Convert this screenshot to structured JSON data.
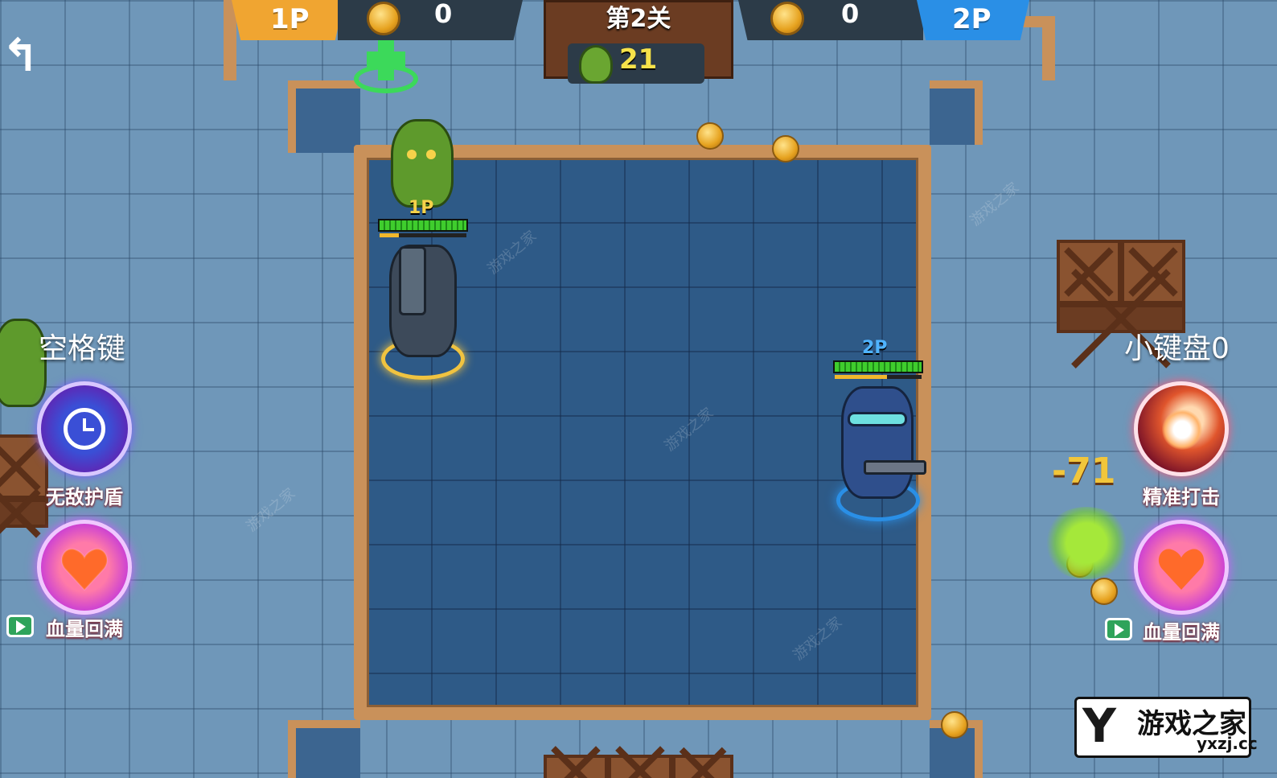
{
  "hud": {
    "p1_label": "1P",
    "p1_coins": "0",
    "p2_label": "2P",
    "p2_coins": "0",
    "level_title": "第2关",
    "zombies_left": "21",
    "back_icon": "back-arrow-icon"
  },
  "players": {
    "p1": {
      "tag": "1P",
      "hp_fraction": 1.0,
      "xp_fraction": 0.22,
      "color": "#f0a531"
    },
    "p2": {
      "tag": "2P",
      "hp_fraction": 1.0,
      "xp_fraction": 0.6,
      "color": "#2a8fe6"
    }
  },
  "skills": {
    "left": {
      "key_label": "空格键",
      "primary_name": "无敌护盾",
      "primary_icon": "clock-shield-icon",
      "heal_name": "血量回满",
      "heal_icon": "heart-icon"
    },
    "right": {
      "key_label": "小键盘0",
      "primary_name": "精准打击",
      "primary_icon": "meteor-strike-icon",
      "heal_name": "血量回满",
      "heal_icon": "heart-icon"
    }
  },
  "effects": {
    "damage_number": "-71"
  },
  "watermark_logo": {
    "mark": "Y",
    "name": "游戏之家",
    "domain": "yxzj.cc"
  },
  "colors": {
    "arena_border": "#c9915a",
    "arena_floor": "#2e5a87",
    "p1": "#f0a531",
    "p2": "#2a8fe6",
    "heal_ring": "#c63ad8"
  }
}
